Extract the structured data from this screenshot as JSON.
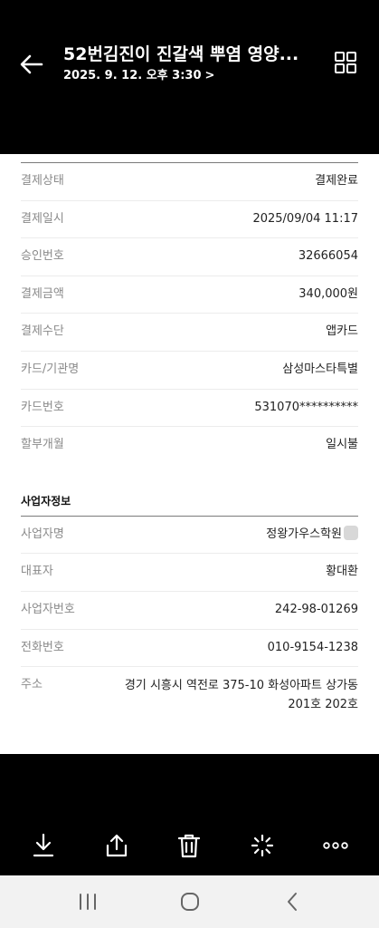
{
  "header": {
    "title": "52번김진이 진갈색 뿌염 영양...",
    "subtitle": "2025. 9. 12. 오후 3:30",
    "subtitle_chevron": ">"
  },
  "payment": {
    "rows": [
      {
        "label": "결제상태",
        "value": "결제완료"
      },
      {
        "label": "결제일시",
        "value": "2025/09/04 11:17"
      },
      {
        "label": "승인번호",
        "value": "32666054"
      },
      {
        "label": "결제금액",
        "value": "340,000원"
      },
      {
        "label": "결제수단",
        "value": "앱카드"
      },
      {
        "label": "카드/기관명",
        "value": "삼성마스타특별"
      },
      {
        "label": "카드번호",
        "value": "531070**********"
      },
      {
        "label": "할부개월",
        "value": "일시불"
      }
    ]
  },
  "business": {
    "section_title": "사업자정보",
    "rows": [
      {
        "label": "사업자명",
        "value": "정왕가우스학원"
      },
      {
        "label": "대표자",
        "value": "황대환"
      },
      {
        "label": "사업자번호",
        "value": "242-98-01269"
      },
      {
        "label": "전화번호",
        "value": "010-9154-1238"
      }
    ],
    "address": {
      "label": "주소",
      "line1": "경기 시흥시 역전로 375-10 화성아파트 상가동",
      "line2": "201호 202호"
    }
  },
  "toolbar": {
    "icons": [
      "download-icon",
      "share-icon",
      "trash-icon",
      "sparkle-icon",
      "more-icon"
    ]
  },
  "navbar": {
    "icons": [
      "recent-apps-icon",
      "home-icon",
      "back-nav-icon"
    ]
  }
}
